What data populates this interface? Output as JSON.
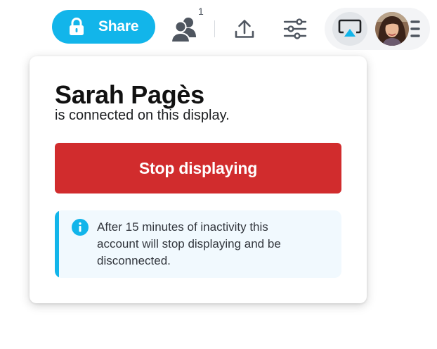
{
  "toolbar": {
    "share_label": "Share",
    "members_count": "1",
    "accent_color": "#12b5ea"
  },
  "icons": {
    "lock": "lock-icon",
    "users": "users-icon",
    "upload": "upload-icon",
    "settings": "sliders-icon",
    "display": "airplay-icon",
    "menu": "menu-icon",
    "info": "info-icon"
  },
  "popover": {
    "user_name": "Sarah Pagès",
    "connected_text": "is connected on this display.",
    "stop_label": "Stop displaying",
    "stop_color": "#d12c2d",
    "info_text": "After 15 minutes of inactivity this account will stop displaying and be disconnected."
  }
}
